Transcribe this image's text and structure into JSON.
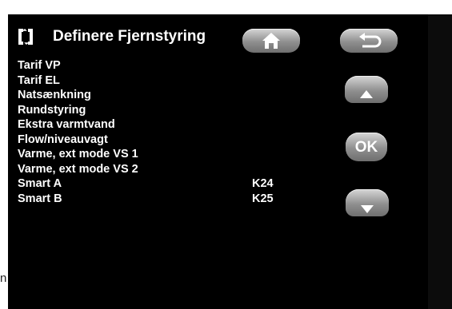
{
  "header": {
    "title": "Definere Fjernstyring",
    "icon": "remote-control-icon"
  },
  "menu": {
    "items": [
      {
        "label": "Tarif VP",
        "value": ""
      },
      {
        "label": "Tarif EL",
        "value": ""
      },
      {
        "label": "Natsænkning",
        "value": ""
      },
      {
        "label": "Rundstyring",
        "value": ""
      },
      {
        "label": "Ekstra varmtvand",
        "value": ""
      },
      {
        "label": "Flow/niveauvagt",
        "value": ""
      },
      {
        "label": "Varme, ext mode VS 1",
        "value": ""
      },
      {
        "label": "Varme, ext mode VS 2",
        "value": ""
      },
      {
        "label": "Smart A",
        "value": "K24"
      },
      {
        "label": "Smart B",
        "value": "K25"
      }
    ]
  },
  "buttons": {
    "home_icon": "home-icon",
    "back_icon": "back-arrow-icon",
    "up_icon": "up-arrow-icon",
    "ok_label": "OK",
    "down_icon": "down-arrow-icon"
  },
  "margin_text": "n",
  "colors": {
    "background": "#000000",
    "text": "#ffffff",
    "button": "#9a9a9a"
  }
}
